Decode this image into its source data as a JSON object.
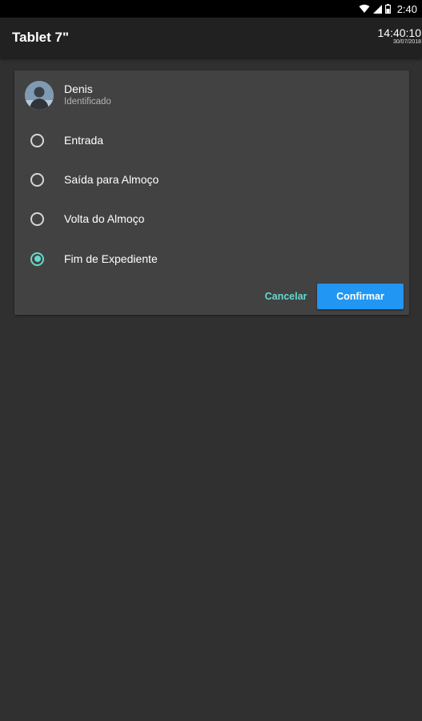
{
  "status_bar": {
    "time": "2:40",
    "icons": [
      "wifi-icon",
      "signal-icon",
      "battery-icon"
    ]
  },
  "app_bar": {
    "title": "Tablet 7\"",
    "clock_time": "14:40:10",
    "clock_date": "30/07/2018"
  },
  "dialog": {
    "user_name": "Denis",
    "user_status": "Identificado",
    "options": [
      {
        "label": "Entrada",
        "checked": false
      },
      {
        "label": "Saída para Almoço",
        "checked": false
      },
      {
        "label": "Volta do Almoço",
        "checked": false
      },
      {
        "label": "Fim de Expediente",
        "checked": true
      }
    ],
    "cancel_label": "Cancelar",
    "confirm_label": "Confirmar"
  },
  "colors": {
    "accent": "#64d8cb",
    "primary_button": "#2196f3",
    "background": "#303030",
    "card": "#424242",
    "app_bar": "#212121"
  }
}
